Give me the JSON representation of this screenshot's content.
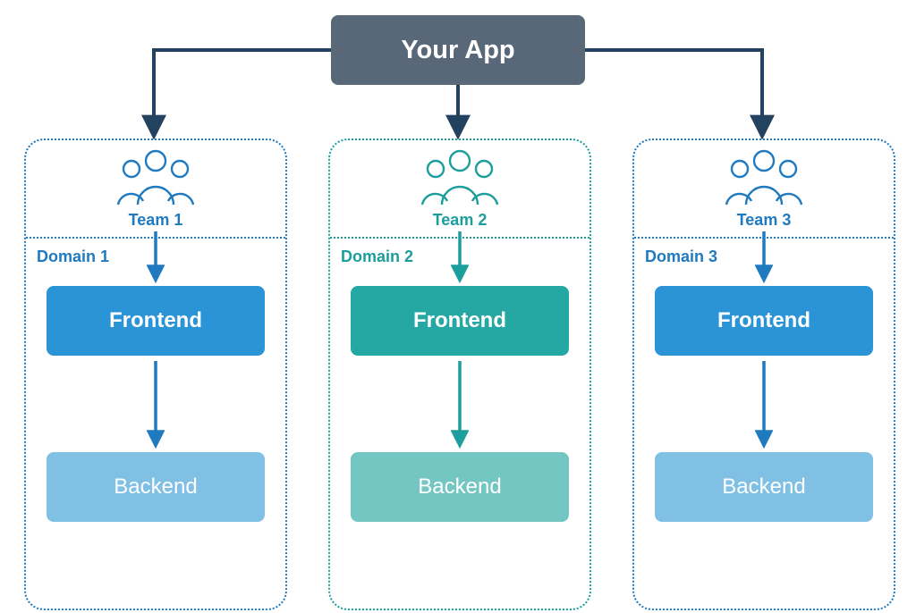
{
  "app": {
    "title": "Your App"
  },
  "domains": [
    {
      "team": "Team 1",
      "domain": "Domain 1",
      "frontend": "Frontend",
      "backend": "Backend",
      "accent": "#1f7abf"
    },
    {
      "team": "Team 2",
      "domain": "Domain 2",
      "frontend": "Frontend",
      "backend": "Backend",
      "accent": "#1c9e9c"
    },
    {
      "team": "Team 3",
      "domain": "Domain 3",
      "frontend": "Frontend",
      "backend": "Backend",
      "accent": "#1f7abf"
    }
  ]
}
